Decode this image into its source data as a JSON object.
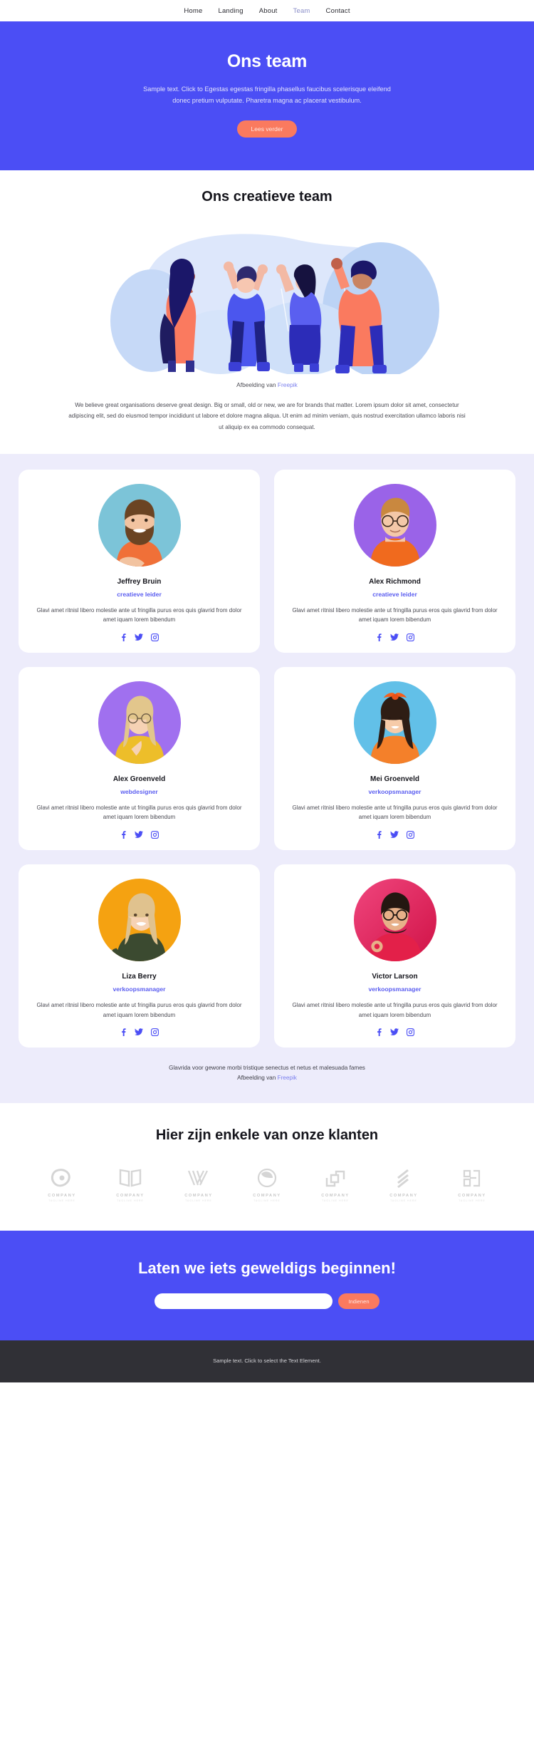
{
  "nav": {
    "items": [
      {
        "label": "Home",
        "active": false
      },
      {
        "label": "Landing",
        "active": false
      },
      {
        "label": "About",
        "active": false
      },
      {
        "label": "Team",
        "active": true
      },
      {
        "label": "Contact",
        "active": false
      }
    ]
  },
  "hero": {
    "title": "Ons team",
    "subtitle": "Sample text. Click to Egestas egestas fringilla phasellus faucibus scelerisque eleifend donec pretium vulputate. Pharetra magna ac placerat vestibulum.",
    "button": "Lees verder",
    "bg_color": "#4b4ef5",
    "button_color": "#fa7a5f"
  },
  "creative": {
    "title": "Ons creatieve team",
    "credit_prefix": "Afbeelding van",
    "credit_link": "Freepik",
    "body": "We believe great organisations deserve great design. Big or small, old or new, we are for brands that matter. Lorem ipsum dolor sit amet, consectetur adipiscing elit, sed do eiusmod tempor incididunt ut labore et dolore magna aliqua. Ut enim ad minim veniam, quis nostrud exercitation ullamco laboris nisi ut aliquip ex ea commodo consequat."
  },
  "team": {
    "bg_color": "#edecfb",
    "role_color": "#5b5ef0",
    "social_color": "#4b4ef5",
    "members": [
      {
        "name": "Jeffrey Bruin",
        "role": "creatieve leider",
        "desc": "Glavi amet ritnisl libero molestie ante ut fringilla purus eros quis glavrid from dolor amet iquam lorem bibendum",
        "avatar_bg": "#7cc4d8",
        "shirt": "#f07038",
        "hair": "#6b4423",
        "skin": "#f2c3a0"
      },
      {
        "name": "Alex Richmond",
        "role": "creatieve leider",
        "desc": "Glavi amet ritnisl libero molestie ante ut fringilla purus eros quis glavrid from dolor amet iquam lorem bibendum",
        "avatar_bg": "#9a63e8",
        "shirt": "#f06a1e",
        "hair": "#c9883f",
        "skin": "#f4c8a8"
      },
      {
        "name": "Alex Groenveld",
        "role": "webdesigner",
        "desc": "Glavi amet ritnisl libero molestie ante ut fringilla purus eros quis glavrid from dolor amet iquam lorem bibendum",
        "avatar_bg": "#a070ef",
        "shirt": "#edbe2a",
        "hair": "#e2c68c",
        "skin": "#f6d2b4"
      },
      {
        "name": "Mei Groenveld",
        "role": "verkoopsmanager",
        "desc": "Glavi amet ritnisl libero molestie ante ut fringilla purus eros quis glavrid from dolor amet iquam lorem bibendum",
        "avatar_bg": "#62c0e8",
        "shirt": "#f4802a",
        "hair": "#2e1d14",
        "skin": "#f6cba9"
      },
      {
        "name": "Liza Berry",
        "role": "verkoopsmanager",
        "desc": "Glavi amet ritnisl libero molestie ante ut fringilla purus eros quis glavrid from dolor amet iquam lorem bibendum",
        "avatar_bg": "#f5a211",
        "shirt": "#3b4a30",
        "hair": "#e0c28e",
        "skin": "#f6d2b4"
      },
      {
        "name": "Victor Larson",
        "role": "verkoopsmanager",
        "desc": "Glavi amet ritnisl libero molestie ante ut fringilla purus eros quis glavrid from dolor amet iquam lorem bibendum",
        "avatar_bg": "#ea2f63",
        "shirt": "#e32049",
        "hair": "#241711",
        "skin": "#e7b089"
      }
    ],
    "footnote_line1": "Glavrida voor gewone morbi tristique senectus et netus et malesuada fames",
    "footnote_prefix": "Afbeelding van",
    "footnote_link": "Freepik"
  },
  "clients": {
    "title": "Hier zijn enkele van onze klanten",
    "logos": [
      {
        "name": "COMPANY",
        "tagline": "TAGLINE HERE",
        "mark": "loop-mark"
      },
      {
        "name": "COMPANY",
        "tagline": "TAGLINE HERE",
        "mark": "book-mark"
      },
      {
        "name": "COMPANY",
        "tagline": "TAGLINE HERE",
        "mark": "chevron-mark"
      },
      {
        "name": "COMPANY",
        "tagline": "TAGLINE HERE",
        "mark": "circle-mark"
      },
      {
        "name": "COMPANY",
        "tagline": "TAGLINE HERE",
        "mark": "square-mark"
      },
      {
        "name": "COMPANY",
        "tagline": "TAGLINE HERE",
        "mark": "stripes-mark"
      },
      {
        "name": "COMPANY",
        "tagline": "TAGLINE HERE",
        "mark": "blocks-mark"
      }
    ]
  },
  "cta": {
    "title": "Laten we iets geweldigs beginnen!",
    "input_value": "",
    "input_placeholder": "",
    "submit": "Indienen"
  },
  "footer": {
    "text": "Sample text. Click to select the Text Element."
  }
}
